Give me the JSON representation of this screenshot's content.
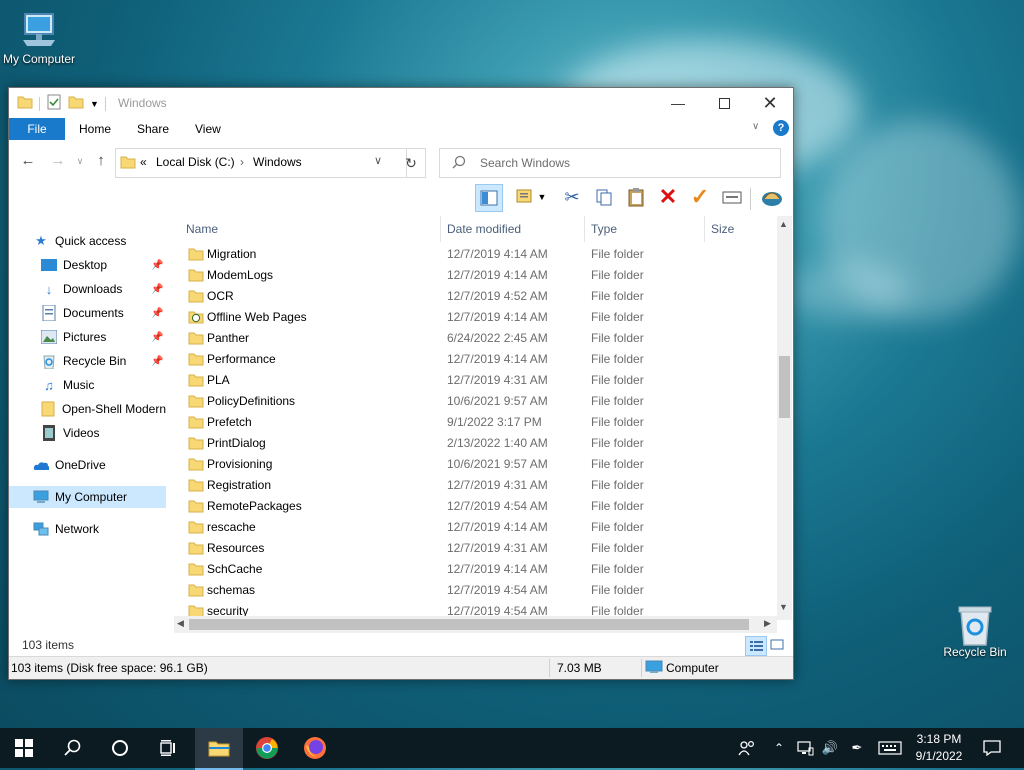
{
  "desktop": {
    "icons": [
      {
        "label": "My Computer"
      },
      {
        "label": "Recycle Bin"
      }
    ]
  },
  "window": {
    "title": "Windows",
    "ribbon_tabs": [
      "File",
      "Home",
      "Share",
      "View"
    ],
    "address": {
      "prefix": "«",
      "segments": [
        "Local Disk (C:)",
        "Windows"
      ]
    },
    "search_placeholder": "Search Windows",
    "nav": {
      "quick_access": "Quick access",
      "pinned": [
        "Desktop",
        "Downloads",
        "Documents",
        "Pictures",
        "Recycle Bin"
      ],
      "other": [
        "Music",
        "Open-Shell Modern",
        "Videos"
      ],
      "onedrive": "OneDrive",
      "my_computer": "My Computer",
      "network": "Network"
    },
    "columns": [
      "Name",
      "Date modified",
      "Type",
      "Size"
    ],
    "rows": [
      {
        "name": "Migration",
        "date": "12/7/2019 4:14 AM",
        "type": "File folder"
      },
      {
        "name": "ModemLogs",
        "date": "12/7/2019 4:14 AM",
        "type": "File folder"
      },
      {
        "name": "OCR",
        "date": "12/7/2019 4:52 AM",
        "type": "File folder"
      },
      {
        "name": "Offline Web Pages",
        "date": "12/7/2019 4:14 AM",
        "type": "File folder"
      },
      {
        "name": "Panther",
        "date": "6/24/2022 2:45 AM",
        "type": "File folder"
      },
      {
        "name": "Performance",
        "date": "12/7/2019 4:14 AM",
        "type": "File folder"
      },
      {
        "name": "PLA",
        "date": "12/7/2019 4:31 AM",
        "type": "File folder"
      },
      {
        "name": "PolicyDefinitions",
        "date": "10/6/2021 9:57 AM",
        "type": "File folder"
      },
      {
        "name": "Prefetch",
        "date": "9/1/2022 3:17 PM",
        "type": "File folder"
      },
      {
        "name": "PrintDialog",
        "date": "2/13/2022 1:40 AM",
        "type": "File folder"
      },
      {
        "name": "Provisioning",
        "date": "10/6/2021 9:57 AM",
        "type": "File folder"
      },
      {
        "name": "Registration",
        "date": "12/7/2019 4:31 AM",
        "type": "File folder"
      },
      {
        "name": "RemotePackages",
        "date": "12/7/2019 4:54 AM",
        "type": "File folder"
      },
      {
        "name": "rescache",
        "date": "12/7/2019 4:14 AM",
        "type": "File folder"
      },
      {
        "name": "Resources",
        "date": "12/7/2019 4:31 AM",
        "type": "File folder"
      },
      {
        "name": "SchCache",
        "date": "12/7/2019 4:14 AM",
        "type": "File folder"
      },
      {
        "name": "schemas",
        "date": "12/7/2019 4:54 AM",
        "type": "File folder"
      },
      {
        "name": "security",
        "date": "12/7/2019 4:54 AM",
        "type": "File folder"
      }
    ],
    "item_count": "103 items",
    "status_left": "103 items (Disk free space: 96.1 GB)",
    "status_size": "7.03 MB",
    "status_location": "Computer"
  },
  "taskbar": {
    "time": "3:18 PM",
    "date": "9/1/2022"
  },
  "colors": {
    "accent": "#1979ca",
    "folder": "#f8d775",
    "taskbar": "#0c1a22"
  }
}
